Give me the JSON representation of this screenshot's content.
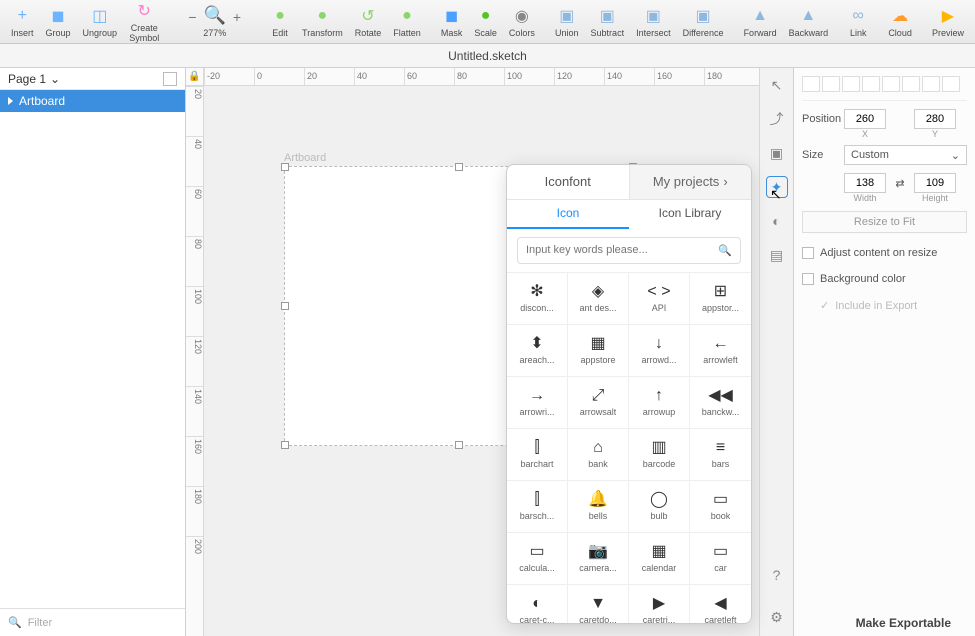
{
  "toolbar": {
    "items": [
      {
        "label": "Insert",
        "icon": "plus",
        "col": "#6cb4ff"
      },
      {
        "label": "Group",
        "icon": "sq",
        "col": "#6cb4ff"
      },
      {
        "label": "Ungroup",
        "icon": "sq2",
        "col": "#6cb4ff"
      },
      {
        "label": "Create Symbol",
        "icon": "swap",
        "col": "#ff7ed0"
      },
      {
        "label": "Edit",
        "icon": "dot",
        "col": "#8ad66a"
      },
      {
        "label": "Transform",
        "icon": "dot",
        "col": "#8ad66a"
      },
      {
        "label": "Rotate",
        "icon": "rot",
        "col": "#8ad66a"
      },
      {
        "label": "Flatten",
        "icon": "dot",
        "col": "#8ad66a"
      },
      {
        "label": "Mask",
        "icon": "sq",
        "col": "#4aa1ff"
      },
      {
        "label": "Scale",
        "icon": "sc",
        "col": "#57c221"
      },
      {
        "label": "Colors",
        "icon": "wheel",
        "col": ""
      },
      {
        "label": "Union",
        "icon": "u",
        "col": "#8fb8e0"
      },
      {
        "label": "Subtract",
        "icon": "u",
        "col": "#8fb8e0"
      },
      {
        "label": "Intersect",
        "icon": "u",
        "col": "#8fb8e0"
      },
      {
        "label": "Difference",
        "icon": "u",
        "col": "#8fb8e0"
      },
      {
        "label": "Forward",
        "icon": "ar",
        "col": "#8fb8e0"
      },
      {
        "label": "Backward",
        "icon": "ar",
        "col": "#8fb8e0"
      },
      {
        "label": "Link",
        "icon": "lk",
        "col": "#8fb8e0"
      },
      {
        "label": "Cloud",
        "icon": "cl",
        "col": "#ff9c2e"
      },
      {
        "label": "Preview",
        "icon": "play",
        "col": "#ffb400"
      }
    ],
    "zoom": "277%"
  },
  "title": "Untitled.sketch",
  "left": {
    "page": "Page 1",
    "artboard": "Artboard",
    "filter": "Filter"
  },
  "ruler_h": [
    "-20",
    "0",
    "20",
    "40",
    "60",
    "80",
    "100",
    "120",
    "140",
    "160",
    "180"
  ],
  "ruler_v": [
    "20",
    "40",
    "60",
    "80",
    "100",
    "120",
    "140",
    "160",
    "180",
    "200"
  ],
  "canvas": {
    "artboard_label": "Artboard"
  },
  "inspector": {
    "position_label": "Position",
    "x": "260",
    "y": "280",
    "x_lbl": "X",
    "y_lbl": "Y",
    "size_label": "Size",
    "size_sel": "Custom",
    "w": "138",
    "h": "109",
    "w_lbl": "Width",
    "h_lbl": "Height",
    "resize_btn": "Resize to Fit",
    "adjust": "Adjust content on resize",
    "bgcolor": "Background color",
    "include": "Include in Export",
    "exportable": "Make Exportable"
  },
  "popover": {
    "tab1_left": "Iconfont",
    "tab1_right": "My projects",
    "tab2_left": "Icon",
    "tab2_right": "Icon Library",
    "search_ph": "Input key words please...",
    "icons": [
      {
        "g": "✻",
        "n": "discon..."
      },
      {
        "g": "◈",
        "n": "ant des..."
      },
      {
        "g": "< >",
        "n": "API"
      },
      {
        "g": "⊞",
        "n": "appstor..."
      },
      {
        "g": "⬍",
        "n": "areach..."
      },
      {
        "g": "▦",
        "n": "appstore"
      },
      {
        "g": "↓",
        "n": "arrowd..."
      },
      {
        "g": "←",
        "n": "arrowleft"
      },
      {
        "g": "→",
        "n": "arrowri..."
      },
      {
        "g": "⤢",
        "n": "arrowsalt"
      },
      {
        "g": "↑",
        "n": "arrowup"
      },
      {
        "g": "◀◀",
        "n": "banckw..."
      },
      {
        "g": "⫿",
        "n": "barchart"
      },
      {
        "g": "⌂",
        "n": "bank"
      },
      {
        "g": "▥",
        "n": "barcode"
      },
      {
        "g": "≡",
        "n": "bars"
      },
      {
        "g": "⫿",
        "n": "barsch..."
      },
      {
        "g": "🔔",
        "n": "bells"
      },
      {
        "g": "◯",
        "n": "bulb"
      },
      {
        "g": "▭",
        "n": "book"
      },
      {
        "g": "▭",
        "n": "calcula..."
      },
      {
        "g": "📷",
        "n": "camera..."
      },
      {
        "g": "▦",
        "n": "calendar"
      },
      {
        "g": "▭",
        "n": "car"
      },
      {
        "g": "◐",
        "n": "caret-c..."
      },
      {
        "g": "▼",
        "n": "caretdo..."
      },
      {
        "g": "▶",
        "n": "caretri..."
      },
      {
        "g": "◀",
        "n": "caretleft"
      }
    ]
  }
}
